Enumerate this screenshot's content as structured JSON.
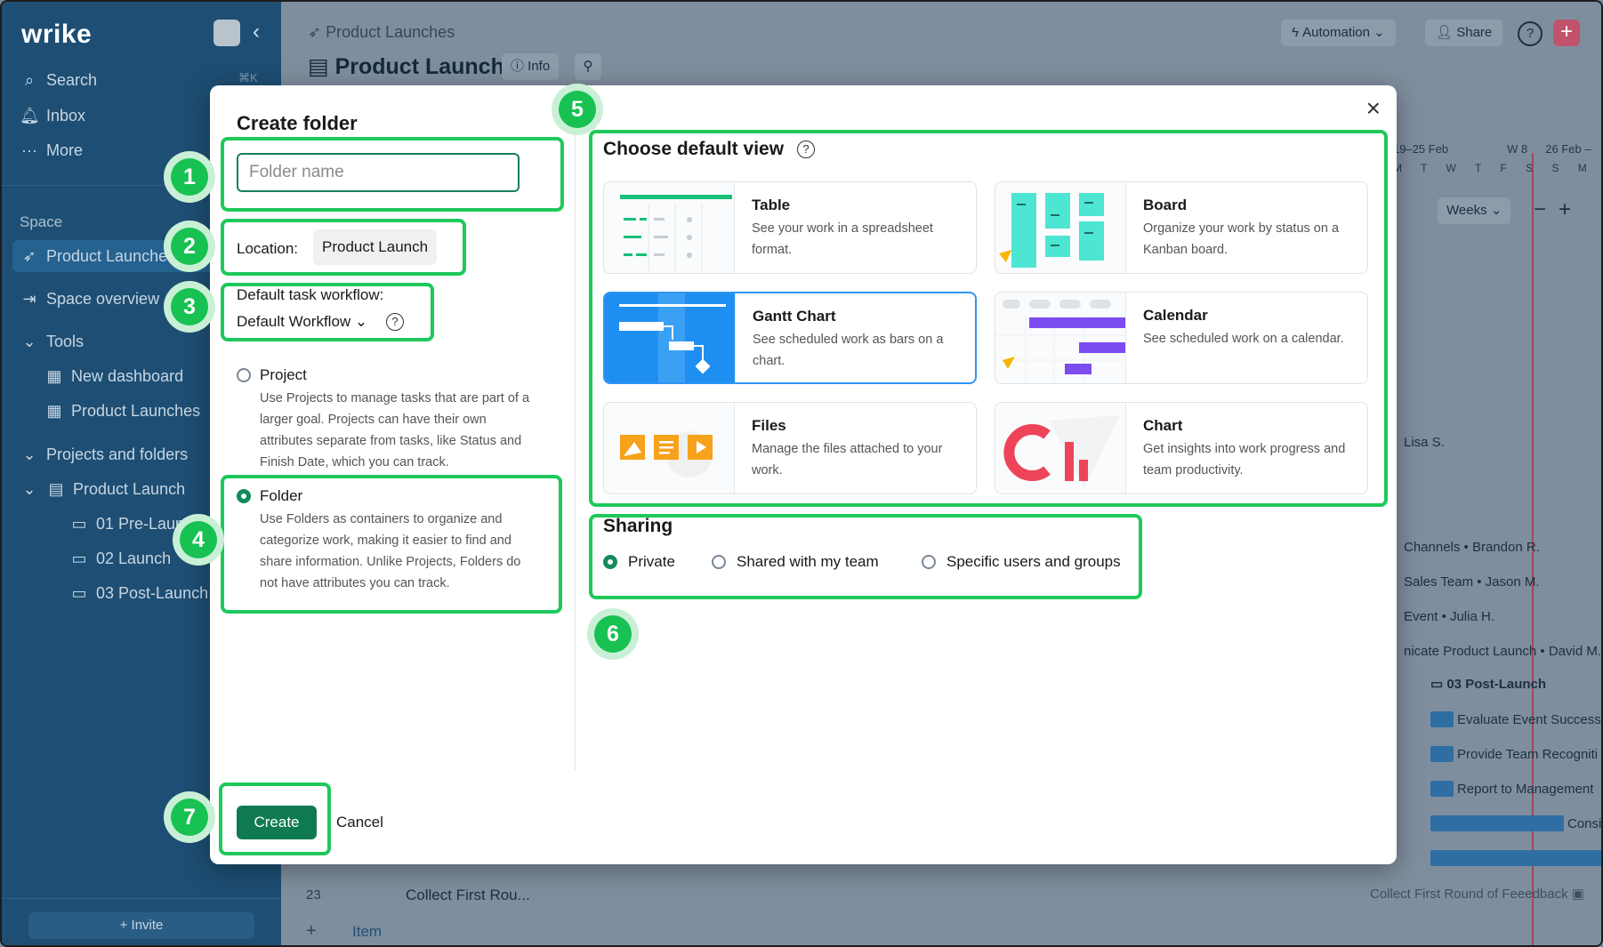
{
  "app": {
    "logo": "wrike",
    "colors": {
      "accent": "#138a5c",
      "highlight": "#1ec85a",
      "sidebar": "#1e4e73",
      "selected_view": "#2f95f2"
    }
  },
  "sidebar": {
    "search": "Search",
    "search_shortcut": "⌘K",
    "inbox": "Inbox",
    "more": "More",
    "space_label": "Space",
    "space_item": "Product Launches",
    "space_overview": "Space overview",
    "tools_label": "Tools",
    "tools": [
      "New dashboard",
      "Product Launches"
    ],
    "projects_label": "Projects and folders",
    "project": "Product Launch",
    "folders": [
      "01 Pre-Launch",
      "02 Launch",
      "03 Post-Launch"
    ],
    "invite": "Invite"
  },
  "header": {
    "breadcrumb": "Product Launches",
    "title": "Product Launch",
    "info": "Info",
    "automation": "Automation",
    "share": "Share"
  },
  "background": {
    "week1": "19–25 Feb",
    "week2": "W 8",
    "week3": "26 Feb –",
    "days": "M T W T F S S M T W",
    "weeks_select": "Weeks",
    "assignees": [
      "Lisa S.",
      "Channels • Brandon R.",
      "Sales Team • Jason M.",
      "Event • Julia H.",
      "nicate Product Launch • David M."
    ],
    "post_launch": "03 Post-Launch",
    "tasks": [
      "Evaluate Event Success",
      "Provide Team Recogniti",
      "Report to Management",
      "Consi"
    ],
    "feedback": "Collect First Round of Feeedback",
    "row_num": "23",
    "row_task": "Collect First Rou...",
    "add_item": "Item"
  },
  "modal": {
    "title": "Create folder",
    "folder_placeholder": "Folder name",
    "location_label": "Location:",
    "location_value": "Product Launch",
    "workflow_label": "Default task workflow:",
    "workflow_value": "Default Workflow",
    "project_title": "Project",
    "project_desc": "Use Projects to manage tasks that are part of a larger goal. Projects can have their own attributes separate from tasks, like Status and Finish Date, which you can track.",
    "folder_title": "Folder",
    "folder_desc": "Use Folders as containers to organize and categorize work, making it easier to find and share information. Unlike Projects, Folders do not have attributes you can track.",
    "default_view_title": "Choose default view",
    "views": [
      {
        "name": "Table",
        "desc": "See your work in a spreadsheet format."
      },
      {
        "name": "Board",
        "desc": "Organize your work by status on a Kanban board."
      },
      {
        "name": "Gantt Chart",
        "desc": "See scheduled work as bars on a chart."
      },
      {
        "name": "Calendar",
        "desc": "See scheduled work on a calendar."
      },
      {
        "name": "Files",
        "desc": "Manage the files attached to your work."
      },
      {
        "name": "Chart",
        "desc": "Get insights into work progress and team productivity."
      }
    ],
    "selected_view": "Gantt Chart",
    "sharing_title": "Sharing",
    "sharing_options": [
      "Private",
      "Shared with my team",
      "Specific users and groups"
    ],
    "selected_sharing": "Private",
    "create": "Create",
    "cancel": "Cancel"
  },
  "annotations": [
    "1",
    "2",
    "3",
    "4",
    "5",
    "6",
    "7"
  ]
}
